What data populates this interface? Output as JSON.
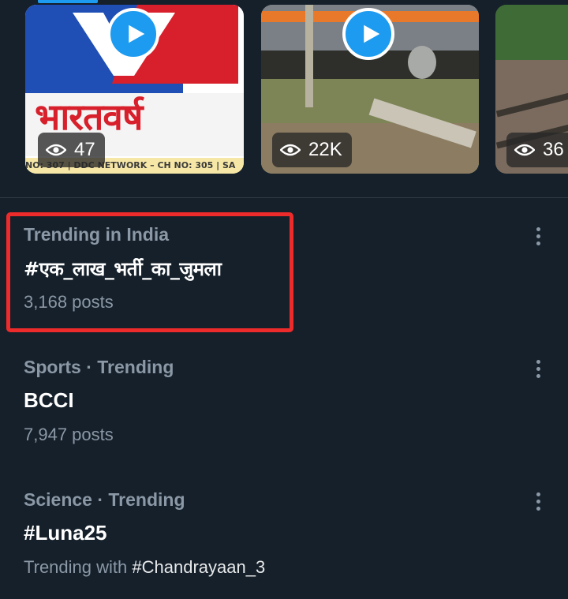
{
  "carousel": {
    "videos": [
      {
        "views": "47",
        "artwork_text": "भारतवर्ष",
        "ticker_text": "NO: 307 | DDC NETWORK – CH NO: 305 | SA"
      },
      {
        "views": "22K"
      },
      {
        "views": "36"
      }
    ]
  },
  "trends": [
    {
      "context": "Trending in India",
      "title": "#एक_लाख_भर्ती_का_जुमला",
      "posts": "3,168 posts",
      "highlighted": true
    },
    {
      "context": "Sports · Trending",
      "title": "BCCI",
      "posts": "7,947 posts"
    },
    {
      "context": "Science · Trending",
      "title": "#Luna25",
      "trending_with_prefix": "Trending with ",
      "trending_with_tag": "#Chandrayaan_3"
    }
  ],
  "colors": {
    "background": "#15202b",
    "accent": "#1d9bf0",
    "secondary_text": "#8b98a5",
    "highlight_box": "#ee2b2b"
  },
  "icons": {
    "play": "play-icon",
    "views": "eye-icon",
    "more": "more-options-icon"
  }
}
